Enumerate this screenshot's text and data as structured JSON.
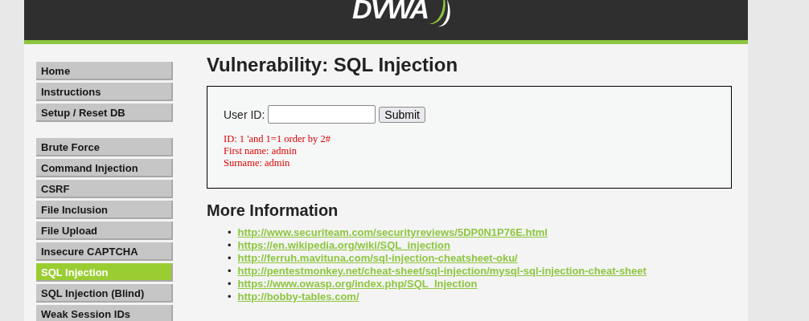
{
  "header": {
    "logo_text": "DVWA"
  },
  "menu": [
    [
      {
        "label": "Home",
        "selected": false
      },
      {
        "label": "Instructions",
        "selected": false
      },
      {
        "label": "Setup / Reset DB",
        "selected": false
      }
    ],
    [
      {
        "label": "Brute Force",
        "selected": false
      },
      {
        "label": "Command Injection",
        "selected": false
      },
      {
        "label": "CSRF",
        "selected": false
      },
      {
        "label": "File Inclusion",
        "selected": false
      },
      {
        "label": "File Upload",
        "selected": false
      },
      {
        "label": "Insecure CAPTCHA",
        "selected": false
      },
      {
        "label": "SQL Injection",
        "selected": true
      },
      {
        "label": "SQL Injection (Blind)",
        "selected": false
      },
      {
        "label": "Weak Session IDs",
        "selected": false
      }
    ]
  ],
  "title": "Vulnerability: SQL Injection",
  "form": {
    "label": "User ID:",
    "button": "Submit"
  },
  "output": [
    "ID: 1 'and 1=1 order by 2#",
    "First name: admin",
    "Surname: admin"
  ],
  "more_info": {
    "heading": "More Information",
    "links": [
      {
        "bullet": "•",
        "url": "http://www.securiteam.com/securityreviews/5DP0N1P76E.html"
      },
      {
        "bullet": "•",
        "url": "https://en.wikipedia.org/wiki/SQL_injection"
      },
      {
        "bullet": "•",
        "url": "http://ferruh.mavituna.com/sql-injection-cheatsheet-oku/"
      },
      {
        "bullet": "•",
        "url": "http://pentestmonkey.net/cheat-sheet/sql-injection/mysql-sql-injection-cheat-sheet"
      },
      {
        "bullet": "•",
        "url": "https://www.owasp.org/index.php/SQL_Injection"
      },
      {
        "bullet": "•",
        "url": "http://bobby-tables.com/"
      }
    ]
  }
}
